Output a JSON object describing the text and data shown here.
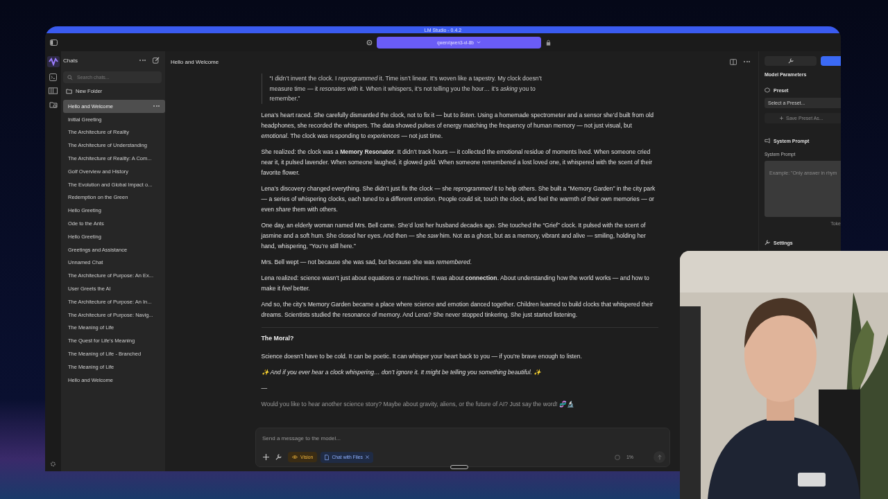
{
  "window": {
    "title": "LM Studio - 0.4.2"
  },
  "toolbar": {
    "model": "qwen/qwen3-vl-8b"
  },
  "sidebar": {
    "title": "Chats",
    "search": {
      "placeholder": "Search chats..."
    },
    "new_folder": "New Folder",
    "chats": [
      {
        "title": "Hello and Welcome",
        "selected": true
      },
      {
        "title": "Initial Greeting",
        "selected": false
      },
      {
        "title": "The Architecture of Reality",
        "selected": false
      },
      {
        "title": "The Architecture of Understanding",
        "selected": false
      },
      {
        "title": "The Architecture of Reality: A Com...",
        "selected": false
      },
      {
        "title": "Golf Overview and History",
        "selected": false
      },
      {
        "title": "The Evolution and Global Impact o...",
        "selected": false
      },
      {
        "title": "Redemption on the Green",
        "selected": false
      },
      {
        "title": "Hello Greeting",
        "selected": false
      },
      {
        "title": "Ode to the Ants",
        "selected": false
      },
      {
        "title": "Hello Greeting",
        "selected": false
      },
      {
        "title": "Greetings and Assistance",
        "selected": false
      },
      {
        "title": "Unnamed Chat",
        "selected": false
      },
      {
        "title": "The Architecture of Purpose: An Ex...",
        "selected": false
      },
      {
        "title": "User Greets the AI",
        "selected": false
      },
      {
        "title": "The Architecture of Purpose: An In...",
        "selected": false
      },
      {
        "title": "The Architecture of Purpose: Navig...",
        "selected": false
      },
      {
        "title": "The Meaning of Life",
        "selected": false
      },
      {
        "title": "The Quest for Life's Meaning",
        "selected": false
      },
      {
        "title": "The Meaning of Life - Branched",
        "selected": false
      },
      {
        "title": "The Meaning of Life",
        "selected": false
      },
      {
        "title": "Hello and Welcome",
        "selected": false
      }
    ]
  },
  "chat": {
    "title": "Hello and Welcome",
    "blocks": [
      {
        "kind": "quote",
        "text": "“I didn’t invent the clock. I *reprogrammed* it. Time isn’t linear. It’s woven like a tapestry. My clock doesn’t measure time — it *resonates* with it. When it whispers, it’s not telling you the hour… it’s *asking* you to remember.”"
      },
      {
        "kind": "paragraph",
        "text": "Lena’s heart raced. She carefully dismantled the clock, not to fix it — but to *listen*. Using a homemade spectrometer and a sensor she’d built from old headphones, she recorded the whispers. The data showed pulses of energy matching the frequency of human memory — not just visual, but *emotional*. The clock was responding to *experiences* — not just time."
      },
      {
        "kind": "paragraph",
        "text": "She realized: the clock was a **Memory Resonator**. It didn’t track hours — it collected the emotional residue of moments lived. When someone cried near it, it pulsed lavender. When someone laughed, it glowed gold. When someone remembered a lost loved one, it whispered with the scent of their favorite flower."
      },
      {
        "kind": "paragraph",
        "text": "Lena’s discovery changed everything. She didn’t just fix the clock — she *reprogrammed* it to help others. She built a “Memory Garden” in the city park — a series of whispering clocks, each tuned to a different emotion. People could sit, touch the clock, and feel the warmth of their own memories — or even *share* them with others."
      },
      {
        "kind": "paragraph",
        "text": "One day, an elderly woman named Mrs. Bell came. She’d lost her husband decades ago. She touched the “Grief” clock. It pulsed with the scent of jasmine and a soft hum. She closed her eyes. And then — she *saw* him. Not as a ghost, but as a memory, vibrant and alive — smiling, holding her hand, whispering, “You’re still here.”"
      },
      {
        "kind": "paragraph",
        "text": "Mrs. Bell wept — not because she was sad, but because she was *remembered*."
      },
      {
        "kind": "paragraph",
        "text": "Lena realized: science wasn’t just about equations or machines. It was about **connection**. About understanding how the world works — and how to make it *feel* better."
      },
      {
        "kind": "paragraph",
        "text": "And so, the city’s Memory Garden became a place where science and emotion danced together. Children learned to build clocks that whispered their dreams. Scientists studied the resonance of memory. And Lena? She never stopped tinkering. She just started listening."
      },
      {
        "kind": "rule"
      },
      {
        "kind": "heading",
        "text": "The Moral?"
      },
      {
        "kind": "paragraph",
        "text": "Science doesn’t have to be cold. It can be poetic. It can whisper your heart back to you — if you’re brave enough to listen."
      },
      {
        "kind": "emphasis",
        "text": "✨ And if you ever hear a clock whispering… don’t ignore it. It might be telling you something beautiful. ✨"
      },
      {
        "kind": "paragraph",
        "text": "—"
      },
      {
        "kind": "muted",
        "text": "Would you like to hear another science story? Maybe about gravity, aliens, or the future of AI? Just say the word! 🧬🔬"
      }
    ]
  },
  "composer": {
    "placeholder": "Send a message to the model...",
    "chips": [
      {
        "kind": "vision",
        "label": "Vision"
      },
      {
        "kind": "files",
        "label": "Chat with Files"
      }
    ],
    "context": "1%"
  },
  "right_panel": {
    "tabs": [
      {
        "kind": "wrench",
        "selected": false
      },
      {
        "kind": "cut",
        "selected": true
      }
    ],
    "title": "Model Parameters",
    "preset": {
      "heading": "Preset",
      "placeholder": "Select a Preset...",
      "save": "Save Preset As..."
    },
    "system_prompt": {
      "heading": "System Prompt",
      "label": "System Prompt",
      "placeholder": "Example: \"Only answer in rhym",
      "tokens": "Toke"
    },
    "settings": "Settings"
  }
}
